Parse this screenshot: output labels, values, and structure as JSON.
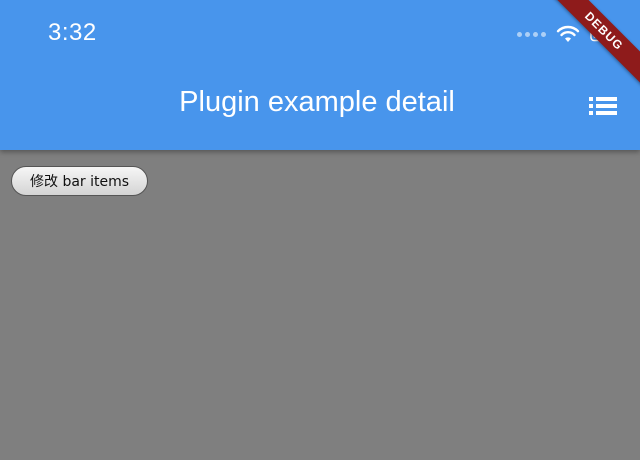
{
  "status_bar": {
    "time": "3:32",
    "icons": [
      "signal-dots-icon",
      "wifi-icon",
      "battery-icon"
    ]
  },
  "app_bar": {
    "title": "Plugin example detail",
    "menu_icon": "list-icon",
    "background_color": "#4895ec"
  },
  "debug_banner": {
    "label": "DEBUG",
    "color": "#8e1b1b"
  },
  "content": {
    "button_label": "修改 bar items",
    "background_color": "#7f7f7f"
  }
}
